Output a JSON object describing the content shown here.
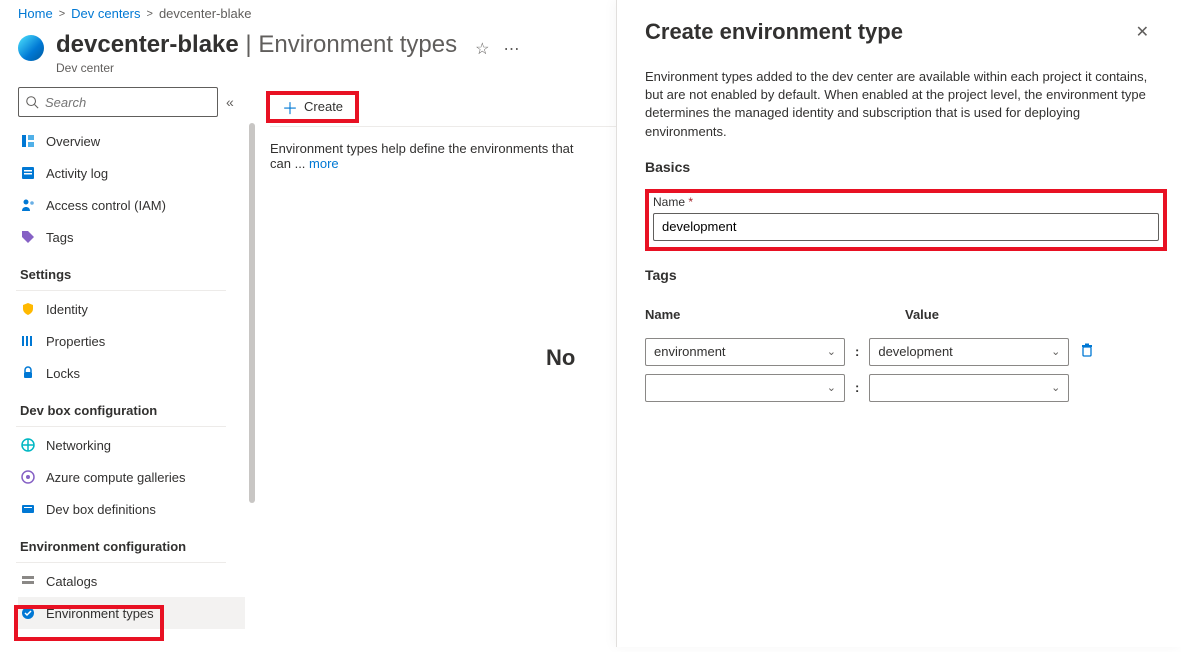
{
  "breadcrumb": {
    "home": "Home",
    "level1": "Dev centers",
    "current": "devcenter-blake"
  },
  "header": {
    "title_main": "devcenter-blake",
    "title_suffix": " | Environment types",
    "subtitle": "Dev center"
  },
  "search": {
    "placeholder": "Search"
  },
  "nav": {
    "overview": "Overview",
    "activitylog": "Activity log",
    "iam": "Access control (IAM)",
    "tags": "Tags",
    "section_settings": "Settings",
    "identity": "Identity",
    "properties": "Properties",
    "locks": "Locks",
    "section_devbox": "Dev box configuration",
    "networking": "Networking",
    "galleries": "Azure compute galleries",
    "definitions": "Dev box definitions",
    "section_envconf": "Environment configuration",
    "catalogs": "Catalogs",
    "envtypes": "Environment types"
  },
  "toolbar": {
    "create": "Create"
  },
  "main": {
    "desc_prefix": "Environment types help define the environments that can",
    "more": "more",
    "no_text": "No"
  },
  "panel": {
    "title": "Create environment type",
    "desc": "Environment types added to the dev center are available within each project it contains, but are not enabled by default. When enabled at the project level, the environment type determines the managed identity and subscription that is used for deploying environments.",
    "basics": "Basics",
    "name_label": "Name ",
    "name_value": "development",
    "tags_label": "Tags",
    "tags_head_name": "Name",
    "tags_head_value": "Value",
    "tag_row1_name": "environment",
    "tag_row1_value": "development"
  }
}
